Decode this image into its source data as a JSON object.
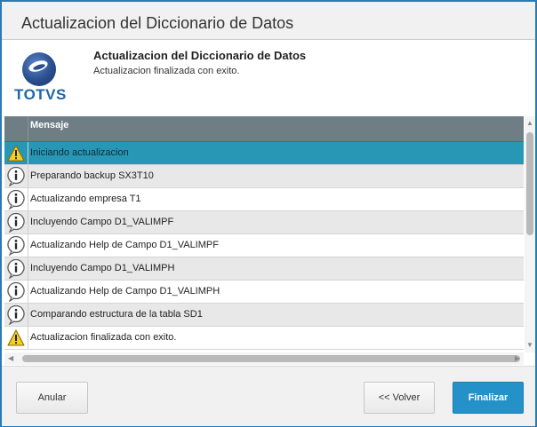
{
  "window": {
    "title": "Actualizacion del Diccionario de Datos"
  },
  "header": {
    "logo_text": "TOTVS",
    "title": "Actualizacion del Diccionario de Datos",
    "subtitle": "Actualizacion finalizada con exito."
  },
  "grid": {
    "column_header": "Mensaje",
    "rows": [
      {
        "icon": "warning-icon",
        "text": "Iniciando actualizacion",
        "selected": true
      },
      {
        "icon": "info-icon",
        "text": "Preparando backup SX3T10"
      },
      {
        "icon": "info-icon",
        "text": "Actualizando empresa T1"
      },
      {
        "icon": "info-icon",
        "text": "Incluyendo Campo D1_VALIMPF"
      },
      {
        "icon": "info-icon",
        "text": "Actualizando Help de Campo D1_VALIMPF"
      },
      {
        "icon": "info-icon",
        "text": "Incluyendo Campo D1_VALIMPH"
      },
      {
        "icon": "info-icon",
        "text": "Actualizando Help de Campo D1_VALIMPH"
      },
      {
        "icon": "info-icon",
        "text": "Comparando estructura de la tabla SD1"
      },
      {
        "icon": "warning-icon",
        "text": "Actualizacion finalizada con exito."
      }
    ]
  },
  "footer": {
    "anular_label": "Anular",
    "volver_label": "<< Volver",
    "finalizar_label": "Finalizar"
  },
  "colors": {
    "accent": "#2492c8",
    "selected_row": "#2897b6",
    "header_bg": "#6f7e84",
    "border": "#2a7ab8"
  }
}
